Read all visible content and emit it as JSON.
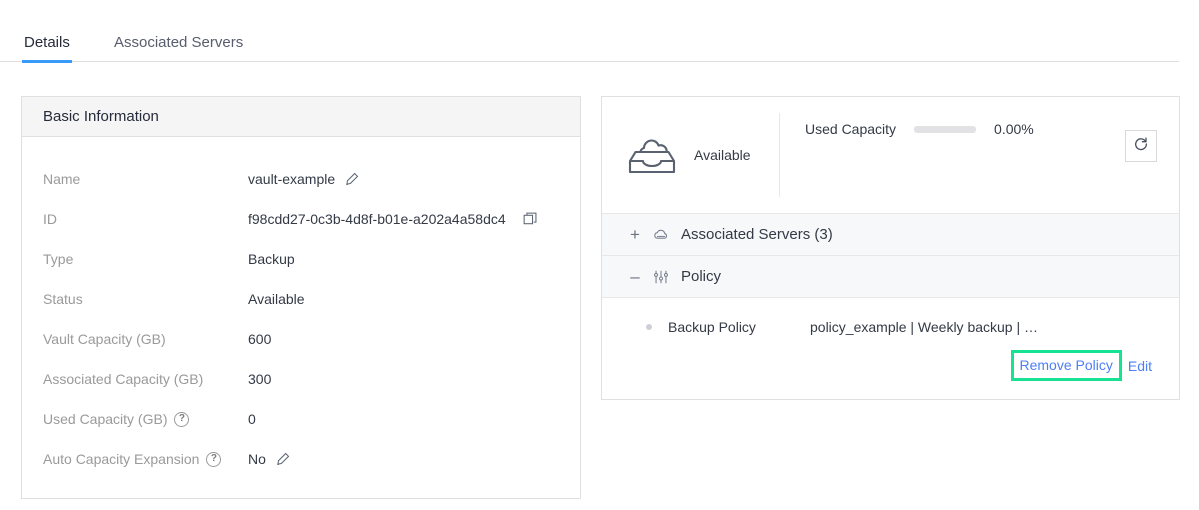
{
  "tabs": [
    {
      "label": "Details",
      "active": true
    },
    {
      "label": "Associated Servers",
      "active": false
    }
  ],
  "basic_information": {
    "title": "Basic Information",
    "rows": [
      {
        "label": "Name",
        "value": "vault-example",
        "edit": true,
        "copy": false,
        "help": false
      },
      {
        "label": "ID",
        "value": "f98cdd27-0c3b-4d8f-b01e-a202a4a58dc4",
        "edit": false,
        "copy": true,
        "help": false
      },
      {
        "label": "Type",
        "value": "Backup",
        "edit": false,
        "copy": false,
        "help": false
      },
      {
        "label": "Status",
        "value": "Available",
        "edit": false,
        "copy": false,
        "help": false
      },
      {
        "label": "Vault Capacity (GB)",
        "value": "600",
        "edit": false,
        "copy": false,
        "help": false
      },
      {
        "label": "Associated Capacity (GB)",
        "value": "300",
        "edit": false,
        "copy": false,
        "help": false
      },
      {
        "label": "Used Capacity (GB)",
        "value": "0",
        "edit": false,
        "copy": false,
        "help": true
      },
      {
        "label": "Auto Capacity Expansion",
        "value": "No",
        "edit": true,
        "copy": false,
        "help": true
      }
    ]
  },
  "vault_summary": {
    "status": "Available",
    "capacity_label": "Used Capacity",
    "capacity_percent_text": "0.00%",
    "capacity_percent_value": 0,
    "refresh_icon": "refresh-icon",
    "vault_icon": "vault-cloud-box-icon"
  },
  "accordions": [
    {
      "toggle": "+",
      "icon": "cloud-server-icon",
      "title": "Associated Servers (3)",
      "expanded": false
    },
    {
      "toggle": "–",
      "icon": "sliders-icon",
      "title": "Policy",
      "expanded": true
    }
  ],
  "policy": {
    "name": "Backup Policy",
    "detail": "policy_example | Weekly backup | En...",
    "actions": {
      "remove": "Remove Policy",
      "edit": "Edit"
    }
  },
  "colors": {
    "tab_active_underline": "#3a9afa",
    "link_blue": "#4d7ff5",
    "highlight_green": "#17e193",
    "panel_border": "#e0e0e0",
    "panel_header_bg": "#f5f5f5",
    "accordion_bg": "#f7f8fa",
    "label_grey": "#9a9a9a",
    "value_dark": "#333a45",
    "progress_track": "#e2e2e4"
  }
}
